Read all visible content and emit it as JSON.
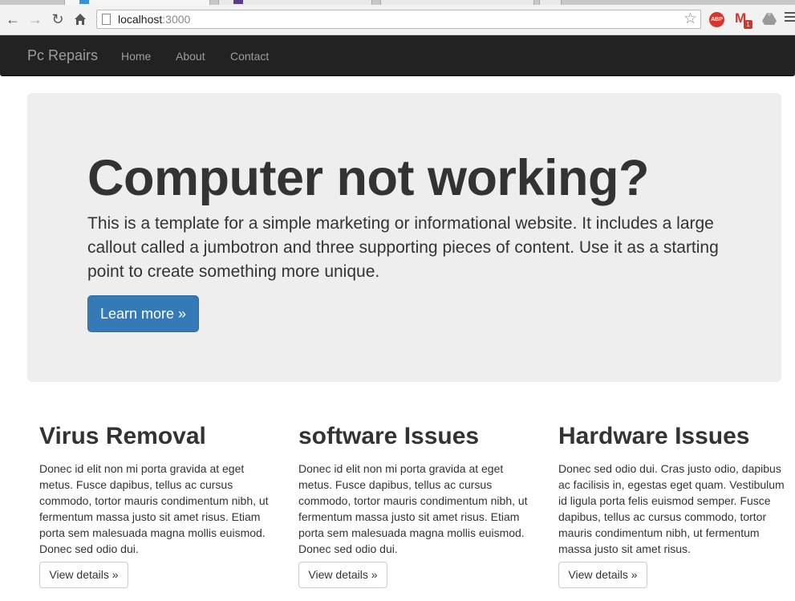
{
  "browser": {
    "url_host": "localhost",
    "url_port": ":3000"
  },
  "navbar": {
    "brand": "Pc Repairs",
    "links": [
      "Home",
      "About",
      "Contact"
    ]
  },
  "jumbotron": {
    "title": "Computer not working?",
    "text": "This is a template for a simple marketing or informational website. It includes a large callout called a jumbotron and three supporting pieces of content. Use it as a starting point to create something more unique.",
    "button": "Learn more »",
    "button_color": "#337ab7"
  },
  "columns": [
    {
      "heading": "Virus Removal",
      "body": "Donec id elit non mi porta gravida at eget metus. Fusce dapibus, tellus ac cursus commodo, tortor mauris condimentum nibh, ut fermentum massa justo sit amet risus. Etiam porta sem malesuada magna mollis euismod. Donec sed odio dui.",
      "button": "View details »"
    },
    {
      "heading": "software Issues",
      "body": "Donec id elit non mi porta gravida at eget metus. Fusce dapibus, tellus ac cursus commodo, tortor mauris condimentum nibh, ut fermentum massa justo sit amet risus. Etiam porta sem malesuada magna mollis euismod. Donec sed odio dui.",
      "button": "View details »"
    },
    {
      "heading": "Hardware Issues",
      "body": "Donec sed odio dui. Cras justo odio, dapibus ac facilisis in, egestas eget quam. Vestibulum id ligula porta felis euismod semper. Fusce dapibus, tellus ac cursus commodo, tortor mauris condimentum nibh, ut fermentum massa justo sit amet risus.",
      "button": "View details »"
    }
  ],
  "extensions": {
    "abp_label": "ABP",
    "gmail_label": "M",
    "gmail_badge": "1"
  },
  "icons": [
    "back-icon",
    "forward-icon",
    "reload-icon",
    "home-icon",
    "page-icon",
    "star-icon",
    "adblock-icon",
    "gmail-icon",
    "drive-icon",
    "menu-icon"
  ]
}
